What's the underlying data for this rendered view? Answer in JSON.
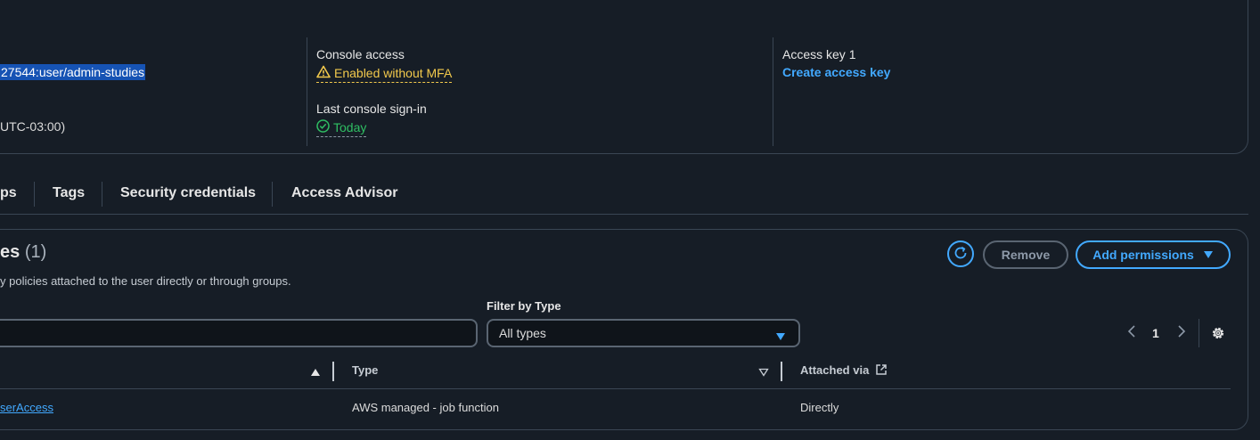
{
  "summary": {
    "arn_fragment": "27544:user/admin-studies",
    "timezone_fragment": "UTC-03:00)",
    "console_access_label": "Console access",
    "console_access_value": "Enabled without MFA",
    "last_signin_label": "Last console sign-in",
    "last_signin_value": "Today",
    "access_key_label": "Access key 1",
    "create_access_key": "Create access key"
  },
  "tabs": [
    {
      "label": "ps"
    },
    {
      "label": "Tags"
    },
    {
      "label": "Security credentials"
    },
    {
      "label": "Access Advisor"
    }
  ],
  "permissions": {
    "title_fragment": "es",
    "count": "(1)",
    "description_fragment": "y policies attached to the user directly or through groups.",
    "remove_label": "Remove",
    "add_label": "Add permissions",
    "filter_label": "Filter by Type",
    "filter_value": "All types",
    "page_number": "1",
    "columns": {
      "type": "Type",
      "attached": "Attached via"
    },
    "rows": [
      {
        "policy_fragment": "serAccess",
        "type": "AWS managed - job function",
        "attached": "Directly"
      }
    ]
  },
  "colors": {
    "accent": "#42a9ff",
    "warning": "#f2c94c",
    "success": "#2fbf63",
    "background": "#161d26"
  }
}
